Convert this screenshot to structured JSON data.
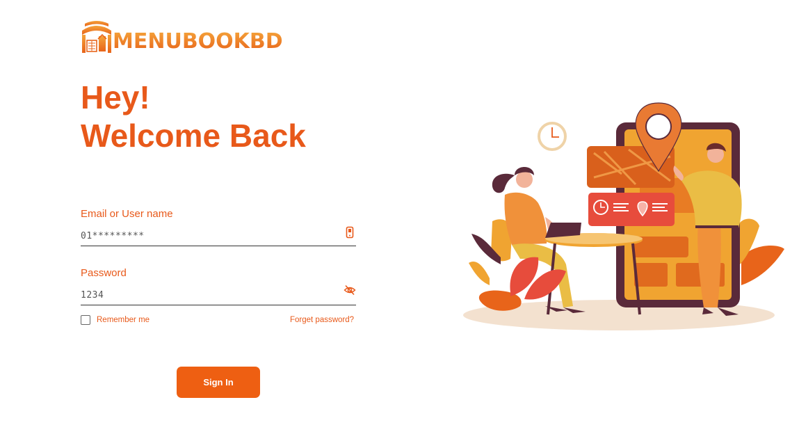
{
  "brand": {
    "name": "MENUBOOKBD"
  },
  "heading": {
    "line1": "Hey!",
    "line2": "Welcome Back"
  },
  "form": {
    "email": {
      "label": "Email or User name",
      "value": "01*********",
      "icon": "phone-icon"
    },
    "password": {
      "label": "Password",
      "value": "1234",
      "icon": "eye-off-icon"
    },
    "remember_label": "Remember me",
    "remember_checked": false,
    "forgot_label": "Forget password?",
    "submit_label": "Sign In"
  },
  "colors": {
    "accent": "#e8591a",
    "button": "#ee5f12"
  }
}
